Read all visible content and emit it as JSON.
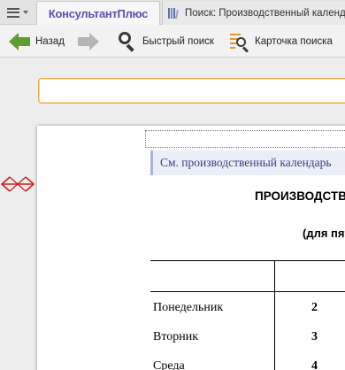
{
  "tabbar": {
    "brand": "КонсультантПлюс",
    "search_tab": "Поиск: Производственный календарь"
  },
  "toolbar": {
    "back_label": "Назад",
    "quick_search_label": "Быстрый поиск",
    "card_search_label": "Карточка поиска"
  },
  "search": {
    "value": ""
  },
  "document": {
    "see_also": "См. производственный календарь",
    "title": "ПРОИЗВОДСТВЕННЫЙ КАЛЕНДАРЬ",
    "subtitle": "(для пятидневной рабочей недели)",
    "rows": [
      {
        "day": "Понедельник",
        "num": "2"
      },
      {
        "day": "Вторник",
        "num": "3"
      },
      {
        "day": "Среда",
        "num": "4"
      }
    ]
  },
  "colors": {
    "accent_green": "#5f9e2e",
    "brand_purple": "#5b4fb3",
    "input_border": "#e7a944",
    "splitter_red": "#cc1f1f"
  }
}
